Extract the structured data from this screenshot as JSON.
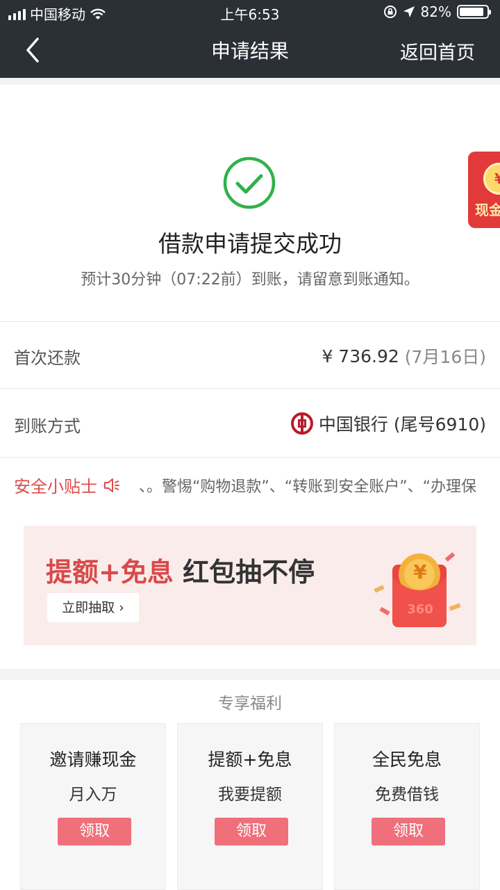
{
  "status_bar": {
    "carrier": "中国移动",
    "time": "上午6:53",
    "battery": "82%"
  },
  "nav": {
    "title": "申请结果",
    "home": "返回首页"
  },
  "result": {
    "title": "借款申请提交成功",
    "subtitle": "预计30分钟（07:22前）到账，请留意到账通知。"
  },
  "cash_badge": {
    "symbol": "¥",
    "text": "现金"
  },
  "rows": {
    "first_repay_label": "首次还款",
    "first_repay_amount": "¥ 736.92",
    "first_repay_date": "(7月16日)",
    "method_label": "到账方式",
    "method_value": "中国银行 (尾号6910)"
  },
  "tips": {
    "label": "安全小贴士",
    "text": "、。警惕“购物退款”、“转账到安全账户”、“办理保"
  },
  "banner": {
    "highlight": "提额+免息",
    "rest": " 红包抽不停",
    "button": "立即抽取 ›",
    "envelope_logo": "360",
    "coin_symbol": "¥"
  },
  "benefits": {
    "title": "专享福利",
    "cards": [
      {
        "title": "邀请赚现金",
        "subtitle": "月入万",
        "button": "领取"
      },
      {
        "title": "提额+免息",
        "subtitle": "我要提额",
        "button": "领取"
      },
      {
        "title": "全民免息",
        "subtitle": "免费借钱",
        "button": "领取"
      }
    ]
  },
  "colors": {
    "header_bg": "#2b2f36",
    "success_green": "#2fb14a",
    "accent_red": "#e04a4a",
    "claim_button": "#ef6f7a"
  }
}
